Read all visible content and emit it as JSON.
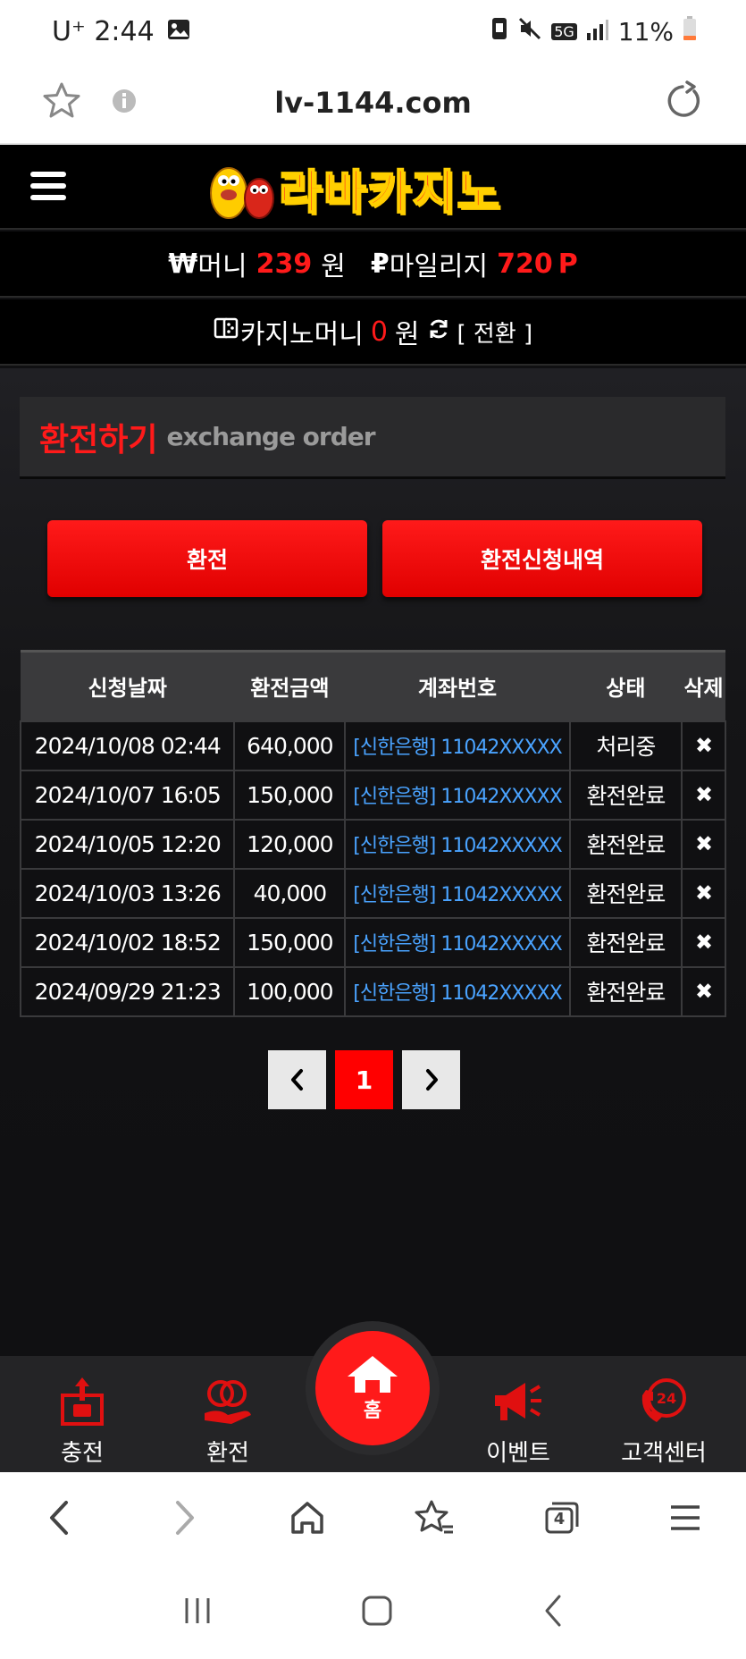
{
  "status_bar": {
    "carrier_time": "U⁺ 2:44",
    "network": "5G",
    "battery": "11%"
  },
  "browser": {
    "url": "lv-1144.com"
  },
  "site": {
    "logo_text": "라바카지노",
    "money": {
      "symbol": "₩",
      "label": "머니",
      "value": "239",
      "unit": "원"
    },
    "mileage": {
      "symbol": "₽",
      "label": "마일리지",
      "value": "720",
      "unit": "P"
    },
    "casino": {
      "label": "카지노머니",
      "value": "0",
      "unit": "원",
      "convert": "[ 전환 ]"
    },
    "panel": {
      "title_kr": "환전하기",
      "title_en": "exchange order"
    },
    "buttons": {
      "exchange": "환전",
      "history": "환전신청내역"
    },
    "table": {
      "headers": [
        "신청날짜",
        "환전금액",
        "계좌번호",
        "상태",
        "삭제"
      ],
      "rows": [
        {
          "date": "2024/10/08 02:44",
          "amount": "640,000",
          "account": "[신한은행] 11042XXXXX",
          "status": "처리중",
          "delete": "✖"
        },
        {
          "date": "2024/10/07 16:05",
          "amount": "150,000",
          "account": "[신한은행] 11042XXXXX",
          "status": "환전완료",
          "delete": "✖"
        },
        {
          "date": "2024/10/05 12:20",
          "amount": "120,000",
          "account": "[신한은행] 11042XXXXX",
          "status": "환전완료",
          "delete": "✖"
        },
        {
          "date": "2024/10/03 13:26",
          "amount": "40,000",
          "account": "[신한은행] 11042XXXXX",
          "status": "환전완료",
          "delete": "✖"
        },
        {
          "date": "2024/10/02 18:52",
          "amount": "150,000",
          "account": "[신한은행] 11042XXXXX",
          "status": "환전완료",
          "delete": "✖"
        },
        {
          "date": "2024/09/29 21:23",
          "amount": "100,000",
          "account": "[신한은행] 11042XXXXX",
          "status": "환전완료",
          "delete": "✖"
        }
      ]
    },
    "pager": {
      "prev": "‹",
      "current": "1",
      "next": "›"
    },
    "bottom_nav": {
      "charge": "충전",
      "exchange": "환전",
      "home": "홈",
      "event": "이벤트",
      "support": "고객센터",
      "support_badge": "24"
    }
  },
  "browser_nav": {
    "tabs_count": "4"
  },
  "colors": {
    "accent": "#ff1a1a",
    "link": "#4aa3ff",
    "bg": "#101012"
  }
}
